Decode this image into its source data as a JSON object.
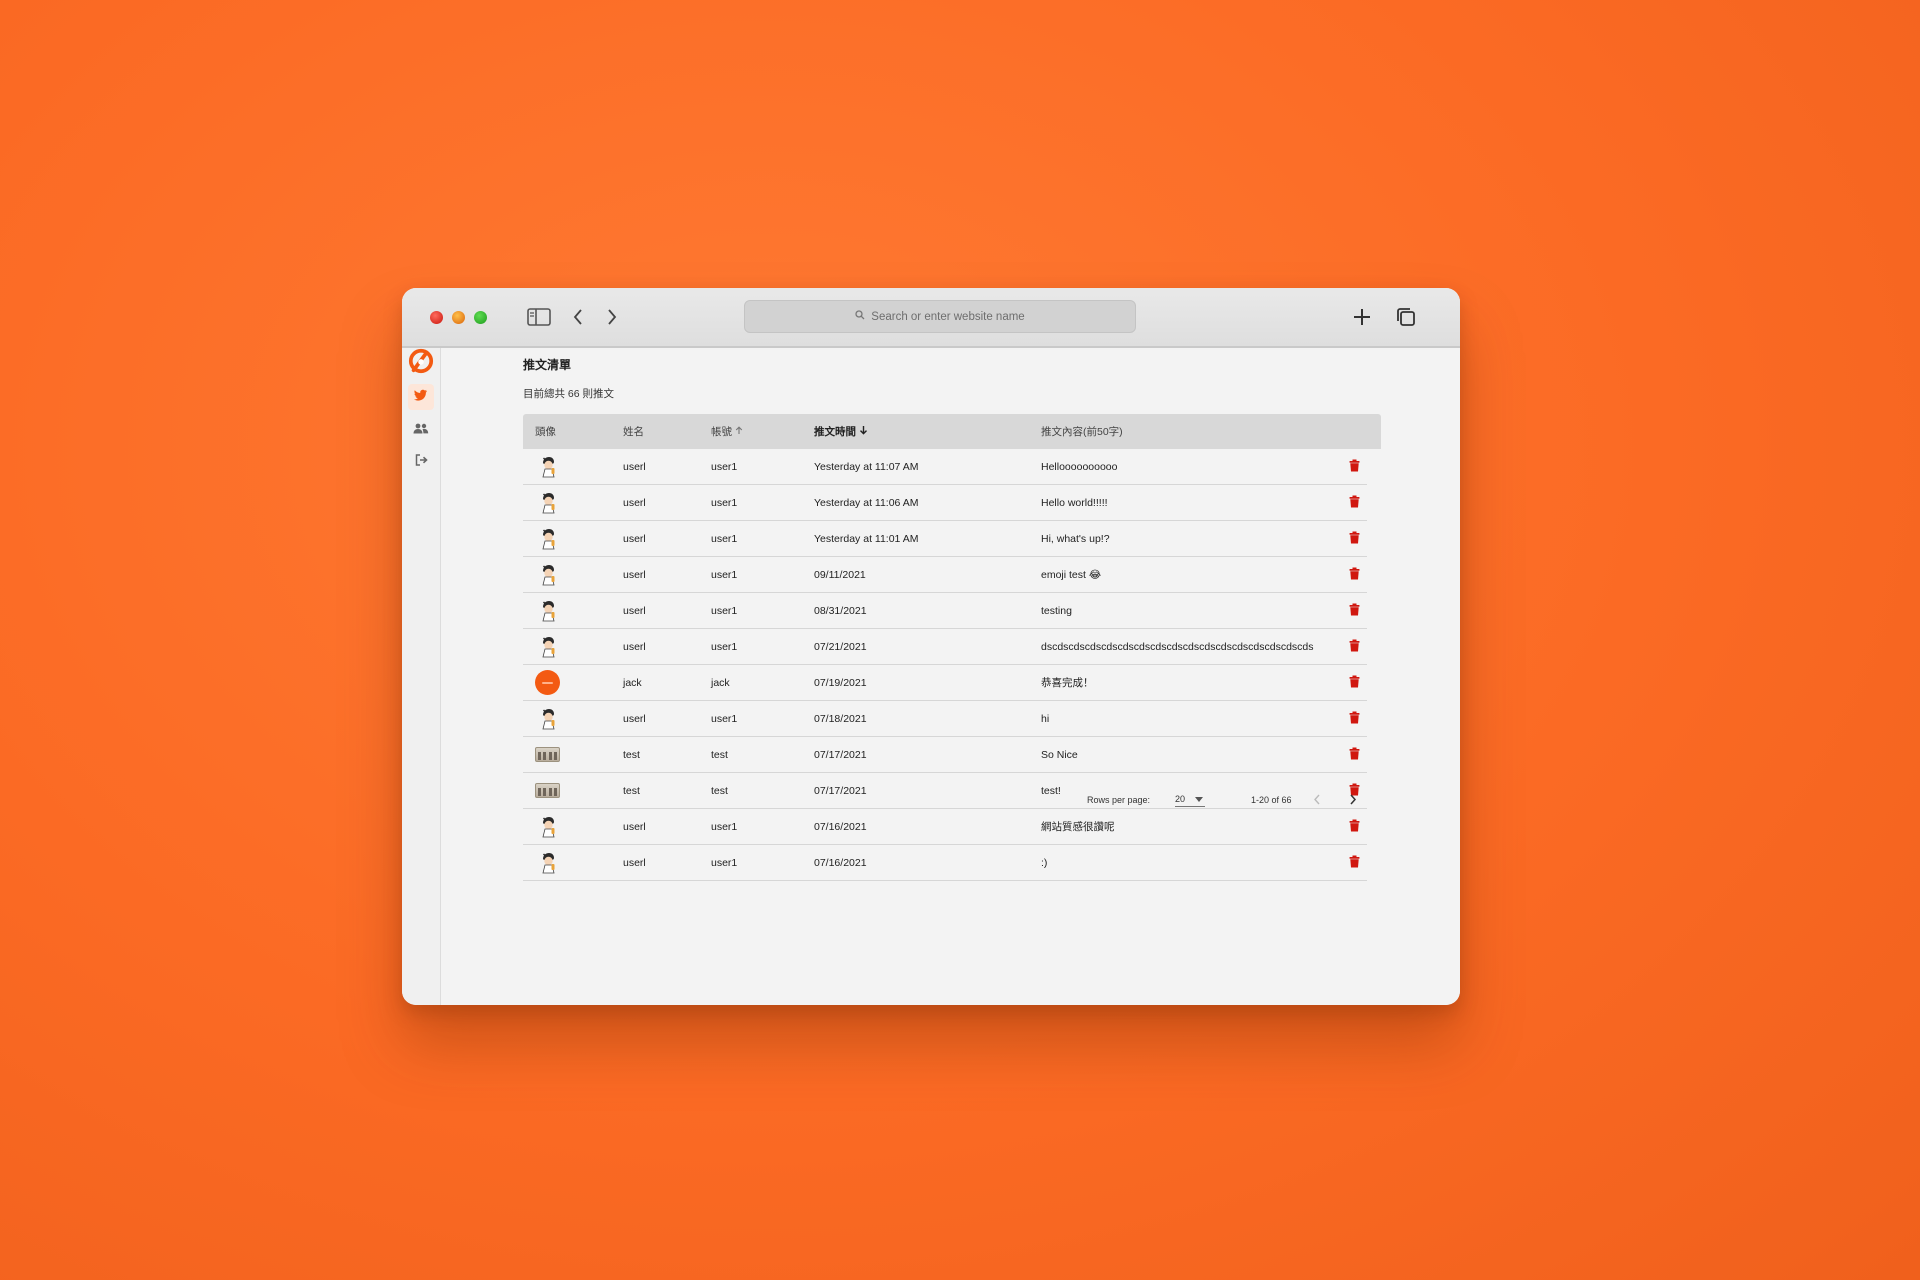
{
  "browser": {
    "address_placeholder": "Search or enter website name"
  },
  "page": {
    "title": "推文清單",
    "subtitle": "目前總共 66 則推文"
  },
  "table": {
    "headers": {
      "avatar": "頭像",
      "name": "姓名",
      "account": "帳號",
      "time": "推文時間",
      "content": "推文內容(前50字)"
    },
    "rows": [
      {
        "avatar": "cartoon-avatar",
        "name": "userl",
        "account": "user1",
        "time": "Yesterday at 11:07 AM",
        "content": "Helloooooooooo"
      },
      {
        "avatar": "cartoon-avatar",
        "name": "userl",
        "account": "user1",
        "time": "Yesterday at 11:06 AM",
        "content": "Hello world!!!!!"
      },
      {
        "avatar": "cartoon-avatar",
        "name": "userl",
        "account": "user1",
        "time": "Yesterday at 11:01 AM",
        "content": "Hi, what's up!?"
      },
      {
        "avatar": "cartoon-avatar",
        "name": "userl",
        "account": "user1",
        "time": "09/11/2021",
        "content": "emoji test 😂"
      },
      {
        "avatar": "cartoon-avatar",
        "name": "userl",
        "account": "user1",
        "time": "08/31/2021",
        "content": "testing"
      },
      {
        "avatar": "cartoon-avatar",
        "name": "userl",
        "account": "user1",
        "time": "07/21/2021",
        "content": "dscdscdscdscdscdscdscdscdscdscdscdscdscdscdscdscds"
      },
      {
        "avatar": "orange-circle-avatar",
        "name": "jack",
        "account": "jack",
        "time": "07/19/2021",
        "content": "恭喜完成！"
      },
      {
        "avatar": "cartoon-avatar",
        "name": "userl",
        "account": "user1",
        "time": "07/18/2021",
        "content": "hi"
      },
      {
        "avatar": "photo-avatar",
        "name": "test",
        "account": "test",
        "time": "07/17/2021",
        "content": "So Nice"
      },
      {
        "avatar": "photo-avatar",
        "name": "test",
        "account": "test",
        "time": "07/17/2021",
        "content": "test!"
      },
      {
        "avatar": "cartoon-avatar",
        "name": "userl",
        "account": "user1",
        "time": "07/16/2021",
        "content": "網站質感很讚呢"
      },
      {
        "avatar": "cartoon-avatar",
        "name": "userl",
        "account": "user1",
        "time": "07/16/2021",
        "content": ":)"
      }
    ]
  },
  "pagination": {
    "rows_label": "Rows per page:",
    "rows_value": "20",
    "range": "1-20 of 66"
  },
  "colors": {
    "brand": "#f35a12",
    "delete": "#d0170f"
  }
}
